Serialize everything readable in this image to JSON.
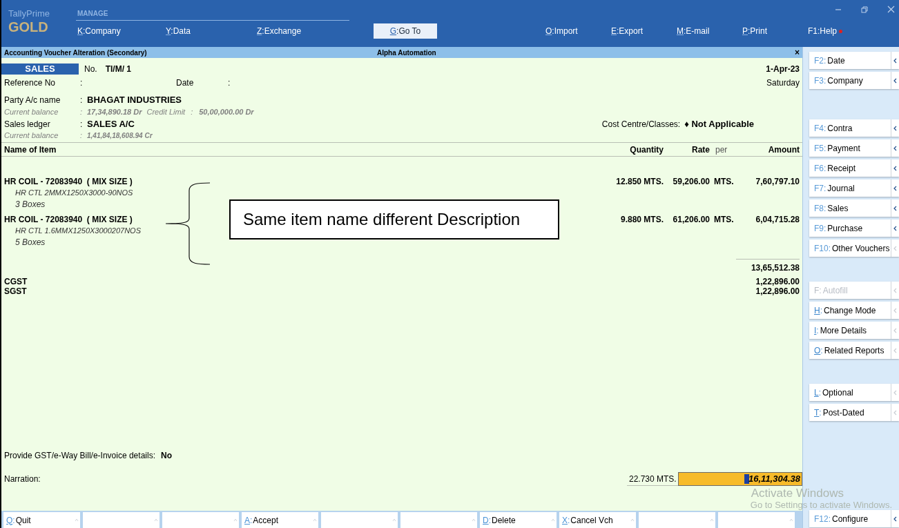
{
  "app": {
    "brand": "TallyPrime",
    "edition": "GOLD",
    "menu_label": "MANAGE",
    "key_sep": ":"
  },
  "top_menu": [
    {
      "kind": "item",
      "key": "K",
      "label": "Company"
    },
    {
      "kind": "item",
      "key": "Y",
      "label": "Data"
    },
    {
      "kind": "item",
      "key": "Z",
      "label": "Exchange"
    },
    {
      "kind": "button",
      "key": "G",
      "label": "Go To"
    },
    {
      "kind": "item",
      "key": "O",
      "label": "Import"
    },
    {
      "kind": "item",
      "key": "E",
      "label": "Export"
    },
    {
      "kind": "item",
      "key": "M",
      "label": "E-mail"
    },
    {
      "kind": "item",
      "key": "P",
      "label": "Print"
    }
  ],
  "help": {
    "key": "F1",
    "label": "Help"
  },
  "title_bar": {
    "title": "Accounting Voucher Alteration (Secondary)",
    "company": "Alpha Automation",
    "close": "×"
  },
  "voucher": {
    "type": "SALES",
    "number_label": "No.",
    "number": "TI/M/ 1",
    "date": "1-Apr-23",
    "day": "Saturday",
    "reference": {
      "label": "Reference No",
      "sep": ":"
    },
    "date_field": {
      "label": "Date",
      "sep": ":"
    },
    "party": {
      "label": "Party A/c name",
      "sep": ":",
      "value": "BHAGAT INDUSTRIES"
    },
    "party_balance": {
      "label": "Current balance",
      "sep": ":",
      "value": "17,34,890.18 Dr",
      "limit_label": "Credit Limit",
      "limit_sep": ":",
      "limit": "50,00,000.00 Dr"
    },
    "ledger": {
      "label": "Sales ledger",
      "sep": ":",
      "value": "SALES A/C"
    },
    "ledger_balance": {
      "label": "Current balance",
      "sep": ":",
      "value": "1,41,84,18,608.94 Cr"
    },
    "cost_centre": {
      "label": "Cost Centre/Classes:",
      "mark": "♦",
      "value": "Not Applicable"
    }
  },
  "columns": {
    "name": "Name of Item",
    "quantity": "Quantity",
    "rate": "Rate",
    "per": "per",
    "amount": "Amount"
  },
  "items": [
    {
      "name": "HR COIL - 72083940  ( MIX SIZE )",
      "description": "HR CTL 2MMX1250X3000-90NOS",
      "packing": "3 Boxes",
      "quantity": "12.850 MTS.",
      "rate": "59,206.00",
      "per": "MTS.",
      "amount": "7,60,797.10"
    },
    {
      "name": "HR COIL - 72083940  ( MIX SIZE )",
      "description": "HR CTL 1.6MMX1250X3000207NOS",
      "packing": "5 Boxes",
      "quantity": "9.880 MTS.",
      "rate": "61,206.00",
      "per": "MTS.",
      "amount": "6,04,715.28"
    }
  ],
  "subtotal": "13,65,512.38",
  "ledgers": [
    {
      "name": "CGST",
      "amount": "1,22,896.00"
    },
    {
      "name": "SGST",
      "amount": "1,22,896.00"
    }
  ],
  "annotation": "Same item name different Description",
  "gst_details": {
    "label": "Provide GST/e-Way Bill/e-Invoice details:",
    "value": "No"
  },
  "narration": {
    "label": "Narration:"
  },
  "total": {
    "quantity": "22.730 MTS.",
    "amount": "16,11,304.38"
  },
  "os_notice": {
    "title": "Activate Windows",
    "text": "Go to Settings to activate Windows."
  },
  "sidebar": {
    "groups": [
      [
        {
          "kind": "fkey",
          "key": "F2",
          "label": "Date",
          "submenu": true,
          "disabled": false
        },
        {
          "kind": "fkey",
          "key": "F3",
          "label": "Company",
          "submenu": true,
          "disabled": false
        }
      ],
      [
        {
          "kind": "fkey",
          "key": "F4",
          "label": "Contra",
          "submenu": true,
          "disabled": false
        },
        {
          "kind": "fkey",
          "key": "F5",
          "label": "Payment",
          "submenu": true,
          "disabled": false
        },
        {
          "kind": "fkey",
          "key": "F6",
          "label": "Receipt",
          "submenu": true,
          "disabled": false
        },
        {
          "kind": "fkey",
          "key": "F7",
          "label": "Journal",
          "submenu": true,
          "disabled": false
        },
        {
          "kind": "fkey",
          "key": "F8",
          "label": "Sales",
          "submenu": true,
          "disabled": false
        },
        {
          "kind": "fkey",
          "key": "F9",
          "label": "Purchase",
          "submenu": true,
          "disabled": false
        },
        {
          "kind": "fkey",
          "key": "F10",
          "label": "Other Vouchers",
          "submenu": false,
          "disabled": false
        }
      ],
      [
        {
          "kind": "letter",
          "key": "F",
          "label": "Autofill",
          "submenu": false,
          "disabled": true
        },
        {
          "kind": "letter",
          "key": "H",
          "label": "Change Mode",
          "submenu": false,
          "disabled": false
        },
        {
          "kind": "letter",
          "key": "I",
          "label": "More Details",
          "submenu": false,
          "disabled": false
        },
        {
          "kind": "letter",
          "key": "O",
          "label": "Related Reports",
          "submenu": false,
          "disabled": false
        }
      ],
      [
        {
          "kind": "letter",
          "key": "L",
          "label": "Optional",
          "submenu": false,
          "disabled": false
        },
        {
          "kind": "letter",
          "key": "T",
          "label": "Post-Dated",
          "submenu": false,
          "disabled": false
        }
      ]
    ],
    "configure": {
      "kind": "fkey",
      "key": "F12",
      "label": "Configure",
      "submenu": true,
      "disabled": false
    }
  },
  "bottom_bar": [
    {
      "kind": "key",
      "key": "Q",
      "label": "Quit"
    },
    {
      "kind": "blank"
    },
    {
      "kind": "blank"
    },
    {
      "kind": "key",
      "key": "A",
      "label": "Accept"
    },
    {
      "kind": "blank"
    },
    {
      "kind": "blank"
    },
    {
      "kind": "key",
      "key": "D",
      "label": "Delete"
    },
    {
      "kind": "key",
      "key": "X",
      "label": "Cancel Vch"
    },
    {
      "kind": "blank"
    },
    {
      "kind": "blank"
    }
  ]
}
